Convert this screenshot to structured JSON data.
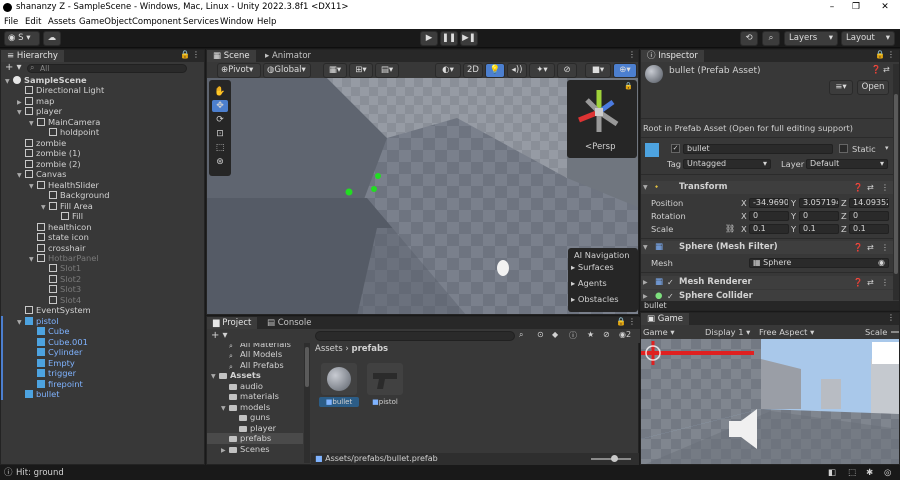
{
  "window": {
    "title": "shananzy Z - SampleScene - Windows, Mac, Linux - Unity 2022.3.8f1 <DX11>",
    "controls": [
      "–",
      "❐",
      "✕"
    ]
  },
  "menu": [
    "File",
    "Edit",
    "Assets",
    "GameObject",
    "Component",
    "Services",
    "Window",
    "Help"
  ],
  "toolbar": {
    "account": "S",
    "layers": "Layers",
    "layout": "Layout"
  },
  "hierarchy": {
    "tab": "Hierarchy",
    "search_placeholder": "All",
    "rows": [
      {
        "label": "SampleScene",
        "indent": 0,
        "arrow": "▼",
        "icon": "scene",
        "bold": true
      },
      {
        "label": "Directional Light",
        "indent": 1,
        "arrow": "",
        "icon": "cube"
      },
      {
        "label": "map",
        "indent": 1,
        "arrow": "▶",
        "icon": "cube"
      },
      {
        "label": "player",
        "indent": 1,
        "arrow": "▼",
        "icon": "cube"
      },
      {
        "label": "MainCamera",
        "indent": 2,
        "arrow": "▼",
        "icon": "cube"
      },
      {
        "label": "holdpoint",
        "indent": 3,
        "arrow": "",
        "icon": "cube"
      },
      {
        "label": "zombie",
        "indent": 1,
        "arrow": "",
        "icon": "cube"
      },
      {
        "label": "zombie (1)",
        "indent": 1,
        "arrow": "",
        "icon": "cube"
      },
      {
        "label": "zombie (2)",
        "indent": 1,
        "arrow": "",
        "icon": "cube"
      },
      {
        "label": "Canvas",
        "indent": 1,
        "arrow": "▼",
        "icon": "cube"
      },
      {
        "label": "HealthSlider",
        "indent": 2,
        "arrow": "▼",
        "icon": "cube"
      },
      {
        "label": "Background",
        "indent": 3,
        "arrow": "",
        "icon": "cube"
      },
      {
        "label": "Fill Area",
        "indent": 3,
        "arrow": "▼",
        "icon": "cube"
      },
      {
        "label": "Fill",
        "indent": 4,
        "arrow": "",
        "icon": "cube"
      },
      {
        "label": "healthicon",
        "indent": 2,
        "arrow": "",
        "icon": "cube"
      },
      {
        "label": "state icon",
        "indent": 2,
        "arrow": "",
        "icon": "cube"
      },
      {
        "label": "crosshair",
        "indent": 2,
        "arrow": "",
        "icon": "cube"
      },
      {
        "label": "HotbarPanel",
        "indent": 2,
        "arrow": "▼",
        "icon": "cube",
        "dim": true
      },
      {
        "label": "Slot1",
        "indent": 3,
        "arrow": "",
        "icon": "cube",
        "dim": true
      },
      {
        "label": "Slot2",
        "indent": 3,
        "arrow": "",
        "icon": "cube",
        "dim": true
      },
      {
        "label": "Slot3",
        "indent": 3,
        "arrow": "",
        "icon": "cube",
        "dim": true
      },
      {
        "label": "Slot4",
        "indent": 3,
        "arrow": "",
        "icon": "cube",
        "dim": true
      },
      {
        "label": "EventSystem",
        "indent": 1,
        "arrow": "",
        "icon": "cube"
      },
      {
        "label": "pistol",
        "indent": 1,
        "arrow": "▼",
        "icon": "prefab",
        "blue": true
      },
      {
        "label": "Cube",
        "indent": 2,
        "arrow": "",
        "icon": "prefab",
        "blue": true
      },
      {
        "label": "Cube.001",
        "indent": 2,
        "arrow": "",
        "icon": "prefab",
        "blue": true
      },
      {
        "label": "Cylinder",
        "indent": 2,
        "arrow": "",
        "icon": "prefab",
        "blue": true
      },
      {
        "label": "Empty",
        "indent": 2,
        "arrow": "",
        "icon": "prefab",
        "blue": true
      },
      {
        "label": "trigger",
        "indent": 2,
        "arrow": "",
        "icon": "prefab",
        "blue": true
      },
      {
        "label": "firepoint",
        "indent": 2,
        "arrow": "",
        "icon": "prefab",
        "blue": true
      },
      {
        "label": "bullet",
        "indent": 1,
        "arrow": "",
        "icon": "prefab",
        "blue": true
      }
    ]
  },
  "scene": {
    "tabs": [
      "Scene",
      "Animator"
    ],
    "pivot": "Pivot",
    "global": "Global",
    "mode_2d": "2D",
    "persp": "<Persp",
    "ai_nav": {
      "title": "AI Navigation",
      "items": [
        "Surfaces",
        "Agents",
        "Obstacles"
      ]
    }
  },
  "project": {
    "tabs": [
      "Project",
      "Console"
    ],
    "badge": "2",
    "tree": [
      {
        "label": "All Materials",
        "indent": 1,
        "arrow": ""
      },
      {
        "label": "All Models",
        "indent": 1,
        "arrow": ""
      },
      {
        "label": "All Prefabs",
        "indent": 1,
        "arrow": ""
      },
      {
        "label": "Assets",
        "indent": 0,
        "arrow": "▼",
        "bold": true
      },
      {
        "label": "audio",
        "indent": 1,
        "arrow": ""
      },
      {
        "label": "materials",
        "indent": 1,
        "arrow": ""
      },
      {
        "label": "models",
        "indent": 1,
        "arrow": "▼"
      },
      {
        "label": "guns",
        "indent": 2,
        "arrow": ""
      },
      {
        "label": "player",
        "indent": 2,
        "arrow": ""
      },
      {
        "label": "prefabs",
        "indent": 1,
        "arrow": "",
        "selected": true
      },
      {
        "label": "Scenes",
        "indent": 1,
        "arrow": "▶"
      }
    ],
    "breadcrumb": [
      "Assets",
      "prefabs"
    ],
    "assets": [
      "bullet",
      "pistol"
    ],
    "footer_path": "Assets/prefabs/bullet.prefab"
  },
  "inspector": {
    "tab": "Inspector",
    "title": "bullet (Prefab Asset)",
    "open_btn": "Open",
    "root_note": "Root in Prefab Asset (Open for full editing support)",
    "object_name": "bullet",
    "static_label": "Static",
    "tag_label": "Tag",
    "tag_value": "Untagged",
    "layer_label": "Layer",
    "layer_value": "Default",
    "transform": {
      "title": "Transform",
      "position_label": "Position",
      "rotation_label": "Rotation",
      "scale_label": "Scale",
      "position": {
        "x": "-34.9690",
        "y": "3.057194",
        "z": "14.09352"
      },
      "rotation": {
        "x": "0",
        "y": "0",
        "z": "0"
      },
      "scale": {
        "x": "0.1",
        "y": "0.1",
        "z": "0.1"
      }
    },
    "mesh_filter": {
      "title": "Sphere (Mesh Filter)",
      "mesh_label": "Mesh",
      "mesh_value": "Sphere"
    },
    "mesh_renderer": "Mesh Renderer",
    "sphere_collider": "Sphere Collider",
    "preview_label": "bullet",
    "axis_labels": [
      "X",
      "Y",
      "Z"
    ]
  },
  "game": {
    "tab": "Game",
    "display_mode": "Game",
    "display": "Display 1",
    "aspect": "Free Aspect",
    "scale": "Scale"
  },
  "status": {
    "text": "Hit: ground"
  },
  "colors": {
    "accent": "#4c7fcf",
    "prefab_blue": "#7fb3ff",
    "health_red": "#e02020",
    "selection": "#2c5d87"
  }
}
